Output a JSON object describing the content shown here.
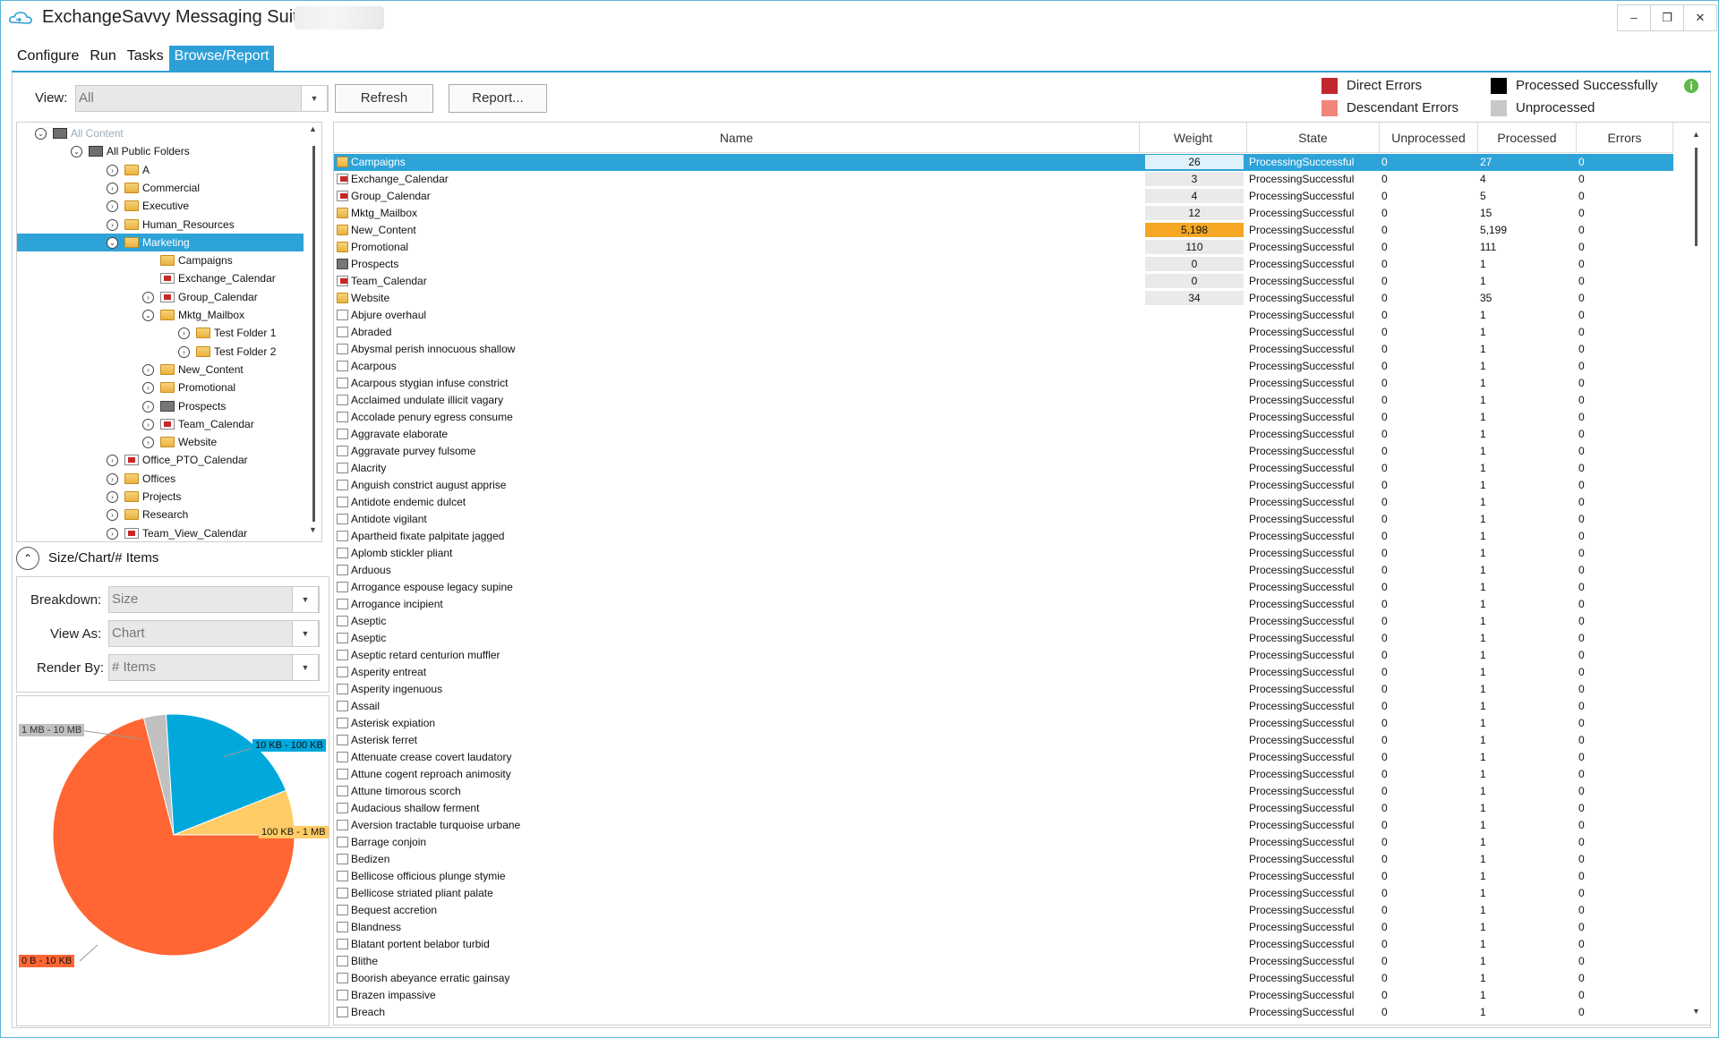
{
  "window": {
    "title": "ExchangeSavvy Messaging Suite -",
    "min_label": "–",
    "restore_label": "❐",
    "close_label": "✕"
  },
  "menu": [
    "Configure",
    "Run",
    "Tasks",
    "Browse/Report"
  ],
  "toolbar": {
    "view_label": "View:",
    "view_value": "All",
    "refresh_label": "Refresh",
    "report_label": "Report..."
  },
  "legend": [
    {
      "label": "Direct Errors",
      "color": "#c0282b"
    },
    {
      "label": "Descendant Errors",
      "color": "#f0857a"
    },
    {
      "label": "Processed Successfully",
      "color": "#000000"
    },
    {
      "label": "Unprocessed",
      "color": "#c8c8c8"
    }
  ],
  "tree": [
    {
      "label": "All Content",
      "icon": "server-icon",
      "exp": "minus",
      "depth": 0,
      "muted": true
    },
    {
      "label": "All Public Folders",
      "icon": "public-folders-icon",
      "exp": "minus",
      "depth": 1
    },
    {
      "label": "A",
      "icon": "folder-icon",
      "exp": "plus",
      "depth": 2
    },
    {
      "label": "Commercial",
      "icon": "folder-icon",
      "exp": "plus",
      "depth": 2
    },
    {
      "label": "Executive",
      "icon": "folder-icon",
      "exp": "plus",
      "depth": 2
    },
    {
      "label": "Human_Resources",
      "icon": "folder-icon",
      "exp": "plus",
      "depth": 2
    },
    {
      "label": "Marketing",
      "icon": "folder-icon",
      "exp": "minus",
      "depth": 2,
      "selected": true
    },
    {
      "label": "Campaigns",
      "icon": "folder-icon",
      "exp": "",
      "depth": 3
    },
    {
      "label": "Exchange_Calendar",
      "icon": "calendar-icon",
      "exp": "",
      "depth": 3
    },
    {
      "label": "Group_Calendar",
      "icon": "calendar-icon",
      "exp": "plus",
      "depth": 3
    },
    {
      "label": "Mktg_Mailbox",
      "icon": "folder-icon",
      "exp": "minus",
      "depth": 3
    },
    {
      "label": "Test Folder 1",
      "icon": "folder-icon",
      "exp": "plus",
      "depth": 4
    },
    {
      "label": "Test Folder 2",
      "icon": "folder-icon",
      "exp": "plus",
      "depth": 4
    },
    {
      "label": "New_Content",
      "icon": "folder-icon",
      "exp": "plus",
      "depth": 3
    },
    {
      "label": "Promotional",
      "icon": "folder-icon",
      "exp": "plus",
      "depth": 3
    },
    {
      "label": "Prospects",
      "icon": "contacts-icon",
      "exp": "plus",
      "depth": 3
    },
    {
      "label": "Team_Calendar",
      "icon": "calendar-icon",
      "exp": "plus",
      "depth": 3
    },
    {
      "label": "Website",
      "icon": "folder-icon",
      "exp": "plus",
      "depth": 3
    },
    {
      "label": "Office_PTO_Calendar",
      "icon": "calendar-icon",
      "exp": "plus",
      "depth": 2
    },
    {
      "label": "Offices",
      "icon": "folder-icon",
      "exp": "plus",
      "depth": 2
    },
    {
      "label": "Projects",
      "icon": "folder-icon",
      "exp": "plus",
      "depth": 2
    },
    {
      "label": "Research",
      "icon": "folder-icon",
      "exp": "plus",
      "depth": 2
    },
    {
      "label": "Team_View_Calendar",
      "icon": "calendar-icon",
      "exp": "plus",
      "depth": 2
    }
  ],
  "size_panel": {
    "title": "Size/Chart/# Items",
    "breakdown_label": "Breakdown:",
    "breakdown_value": "Size",
    "viewas_label": "View As:",
    "viewas_value": "Chart",
    "renderby_label": "Render By:",
    "renderby_value": "# Items"
  },
  "chart_data": {
    "type": "pie",
    "slices": [
      {
        "label": "0 B - 10 KB",
        "value": 71,
        "color": "#ff6633"
      },
      {
        "label": "10 KB - 100 KB",
        "value": 20,
        "color": "#00a8dc"
      },
      {
        "label": "100 KB - 1 MB",
        "value": 6,
        "color": "#ffcc66"
      },
      {
        "label": "1 MB - 10 MB",
        "value": 3,
        "color": "#c0c0c0"
      }
    ]
  },
  "grid": {
    "columns": [
      "Name",
      "Weight",
      "State",
      "Unprocessed",
      "Processed",
      "Errors"
    ],
    "rows": [
      {
        "name": "Campaigns",
        "icon": "folder-icon",
        "weight": "26",
        "state": "ProcessingSuccessful",
        "unprocessed": "0",
        "processed": "27",
        "errors": "0",
        "selected": true
      },
      {
        "name": "Exchange_Calendar",
        "icon": "calendar-icon",
        "weight": "3",
        "state": "ProcessingSuccessful",
        "unprocessed": "0",
        "processed": "4",
        "errors": "0"
      },
      {
        "name": "Group_Calendar",
        "icon": "calendar-icon",
        "weight": "4",
        "state": "ProcessingSuccessful",
        "unprocessed": "0",
        "processed": "5",
        "errors": "0"
      },
      {
        "name": "Mktg_Mailbox",
        "icon": "folder-icon",
        "weight": "12",
        "state": "ProcessingSuccessful",
        "unprocessed": "0",
        "processed": "15",
        "errors": "0"
      },
      {
        "name": "New_Content",
        "icon": "folder-icon",
        "weight": "5,198",
        "state": "ProcessingSuccessful",
        "unprocessed": "0",
        "processed": "5,199",
        "errors": "0",
        "hot": true
      },
      {
        "name": "Promotional",
        "icon": "folder-icon",
        "weight": "110",
        "state": "ProcessingSuccessful",
        "unprocessed": "0",
        "processed": "111",
        "errors": "0"
      },
      {
        "name": "Prospects",
        "icon": "contacts-icon",
        "weight": "0",
        "state": "ProcessingSuccessful",
        "unprocessed": "0",
        "processed": "1",
        "errors": "0"
      },
      {
        "name": "Team_Calendar",
        "icon": "calendar-icon",
        "weight": "0",
        "state": "ProcessingSuccessful",
        "unprocessed": "0",
        "processed": "1",
        "errors": "0"
      },
      {
        "name": "Website",
        "icon": "folder-icon",
        "weight": "34",
        "state": "ProcessingSuccessful",
        "unprocessed": "0",
        "processed": "35",
        "errors": "0"
      },
      {
        "name": "Abjure overhaul",
        "icon": "mail-icon",
        "weight": "",
        "state": "ProcessingSuccessful",
        "unprocessed": "0",
        "processed": "1",
        "errors": "0"
      },
      {
        "name": "Abraded",
        "icon": "mail-icon",
        "weight": "",
        "state": "ProcessingSuccessful",
        "unprocessed": "0",
        "processed": "1",
        "errors": "0"
      },
      {
        "name": "Abysmal perish innocuous shallow",
        "icon": "mail-icon",
        "weight": "",
        "state": "ProcessingSuccessful",
        "unprocessed": "0",
        "processed": "1",
        "errors": "0"
      },
      {
        "name": "Acarpous",
        "icon": "mail-icon",
        "weight": "",
        "state": "ProcessingSuccessful",
        "unprocessed": "0",
        "processed": "1",
        "errors": "0"
      },
      {
        "name": "Acarpous stygian infuse constrict",
        "icon": "mail-icon",
        "weight": "",
        "state": "ProcessingSuccessful",
        "unprocessed": "0",
        "processed": "1",
        "errors": "0"
      },
      {
        "name": "Acclaimed undulate illicit vagary",
        "icon": "mail-icon",
        "weight": "",
        "state": "ProcessingSuccessful",
        "unprocessed": "0",
        "processed": "1",
        "errors": "0"
      },
      {
        "name": "Accolade penury egress consume",
        "icon": "mail-icon",
        "weight": "",
        "state": "ProcessingSuccessful",
        "unprocessed": "0",
        "processed": "1",
        "errors": "0"
      },
      {
        "name": "Aggravate elaborate",
        "icon": "mail-icon",
        "weight": "",
        "state": "ProcessingSuccessful",
        "unprocessed": "0",
        "processed": "1",
        "errors": "0"
      },
      {
        "name": "Aggravate purvey fulsome",
        "icon": "mail-icon",
        "weight": "",
        "state": "ProcessingSuccessful",
        "unprocessed": "0",
        "processed": "1",
        "errors": "0"
      },
      {
        "name": "Alacrity",
        "icon": "mail-icon",
        "weight": "",
        "state": "ProcessingSuccessful",
        "unprocessed": "0",
        "processed": "1",
        "errors": "0"
      },
      {
        "name": "Anguish constrict august apprise",
        "icon": "mail-icon",
        "weight": "",
        "state": "ProcessingSuccessful",
        "unprocessed": "0",
        "processed": "1",
        "errors": "0"
      },
      {
        "name": "Antidote endemic dulcet",
        "icon": "mail-icon",
        "weight": "",
        "state": "ProcessingSuccessful",
        "unprocessed": "0",
        "processed": "1",
        "errors": "0"
      },
      {
        "name": "Antidote vigilant",
        "icon": "mail-icon",
        "weight": "",
        "state": "ProcessingSuccessful",
        "unprocessed": "0",
        "processed": "1",
        "errors": "0"
      },
      {
        "name": "Apartheid fixate palpitate jagged",
        "icon": "mail-icon",
        "weight": "",
        "state": "ProcessingSuccessful",
        "unprocessed": "0",
        "processed": "1",
        "errors": "0"
      },
      {
        "name": "Aplomb stickler pliant",
        "icon": "mail-icon",
        "weight": "",
        "state": "ProcessingSuccessful",
        "unprocessed": "0",
        "processed": "1",
        "errors": "0"
      },
      {
        "name": "Arduous",
        "icon": "mail-icon",
        "weight": "",
        "state": "ProcessingSuccessful",
        "unprocessed": "0",
        "processed": "1",
        "errors": "0"
      },
      {
        "name": "Arrogance espouse legacy supine",
        "icon": "mail-icon",
        "weight": "",
        "state": "ProcessingSuccessful",
        "unprocessed": "0",
        "processed": "1",
        "errors": "0"
      },
      {
        "name": "Arrogance incipient",
        "icon": "mail-icon",
        "weight": "",
        "state": "ProcessingSuccessful",
        "unprocessed": "0",
        "processed": "1",
        "errors": "0"
      },
      {
        "name": "Aseptic",
        "icon": "mail-icon",
        "weight": "",
        "state": "ProcessingSuccessful",
        "unprocessed": "0",
        "processed": "1",
        "errors": "0"
      },
      {
        "name": "Aseptic",
        "icon": "mail-icon",
        "weight": "",
        "state": "ProcessingSuccessful",
        "unprocessed": "0",
        "processed": "1",
        "errors": "0"
      },
      {
        "name": "Aseptic retard centurion muffler",
        "icon": "mail-icon",
        "weight": "",
        "state": "ProcessingSuccessful",
        "unprocessed": "0",
        "processed": "1",
        "errors": "0"
      },
      {
        "name": "Asperity entreat",
        "icon": "mail-icon",
        "weight": "",
        "state": "ProcessingSuccessful",
        "unprocessed": "0",
        "processed": "1",
        "errors": "0"
      },
      {
        "name": "Asperity ingenuous",
        "icon": "mail-icon",
        "weight": "",
        "state": "ProcessingSuccessful",
        "unprocessed": "0",
        "processed": "1",
        "errors": "0"
      },
      {
        "name": "Assail",
        "icon": "mail-icon",
        "weight": "",
        "state": "ProcessingSuccessful",
        "unprocessed": "0",
        "processed": "1",
        "errors": "0"
      },
      {
        "name": "Asterisk expiation",
        "icon": "mail-icon",
        "weight": "",
        "state": "ProcessingSuccessful",
        "unprocessed": "0",
        "processed": "1",
        "errors": "0"
      },
      {
        "name": "Asterisk ferret",
        "icon": "mail-icon",
        "weight": "",
        "state": "ProcessingSuccessful",
        "unprocessed": "0",
        "processed": "1",
        "errors": "0"
      },
      {
        "name": "Attenuate crease covert laudatory",
        "icon": "mail-icon",
        "weight": "",
        "state": "ProcessingSuccessful",
        "unprocessed": "0",
        "processed": "1",
        "errors": "0"
      },
      {
        "name": "Attune cogent reproach animosity",
        "icon": "mail-icon",
        "weight": "",
        "state": "ProcessingSuccessful",
        "unprocessed": "0",
        "processed": "1",
        "errors": "0"
      },
      {
        "name": "Attune timorous scorch",
        "icon": "mail-icon",
        "weight": "",
        "state": "ProcessingSuccessful",
        "unprocessed": "0",
        "processed": "1",
        "errors": "0"
      },
      {
        "name": "Audacious shallow ferment",
        "icon": "mail-icon",
        "weight": "",
        "state": "ProcessingSuccessful",
        "unprocessed": "0",
        "processed": "1",
        "errors": "0"
      },
      {
        "name": "Aversion tractable turquoise urbane",
        "icon": "mail-icon",
        "weight": "",
        "state": "ProcessingSuccessful",
        "unprocessed": "0",
        "processed": "1",
        "errors": "0"
      },
      {
        "name": "Barrage conjoin",
        "icon": "mail-icon",
        "weight": "",
        "state": "ProcessingSuccessful",
        "unprocessed": "0",
        "processed": "1",
        "errors": "0"
      },
      {
        "name": "Bedizen",
        "icon": "mail-icon",
        "weight": "",
        "state": "ProcessingSuccessful",
        "unprocessed": "0",
        "processed": "1",
        "errors": "0"
      },
      {
        "name": "Bellicose officious plunge stymie",
        "icon": "mail-icon",
        "weight": "",
        "state": "ProcessingSuccessful",
        "unprocessed": "0",
        "processed": "1",
        "errors": "0"
      },
      {
        "name": "Bellicose striated pliant palate",
        "icon": "mail-icon",
        "weight": "",
        "state": "ProcessingSuccessful",
        "unprocessed": "0",
        "processed": "1",
        "errors": "0"
      },
      {
        "name": "Bequest accretion",
        "icon": "mail-icon",
        "weight": "",
        "state": "ProcessingSuccessful",
        "unprocessed": "0",
        "processed": "1",
        "errors": "0"
      },
      {
        "name": "Blandness",
        "icon": "mail-icon",
        "weight": "",
        "state": "ProcessingSuccessful",
        "unprocessed": "0",
        "processed": "1",
        "errors": "0"
      },
      {
        "name": "Blatant portent belabor turbid",
        "icon": "mail-icon",
        "weight": "",
        "state": "ProcessingSuccessful",
        "unprocessed": "0",
        "processed": "1",
        "errors": "0"
      },
      {
        "name": "Blithe",
        "icon": "mail-icon",
        "weight": "",
        "state": "ProcessingSuccessful",
        "unprocessed": "0",
        "processed": "1",
        "errors": "0"
      },
      {
        "name": "Boorish abeyance erratic gainsay",
        "icon": "mail-icon",
        "weight": "",
        "state": "ProcessingSuccessful",
        "unprocessed": "0",
        "processed": "1",
        "errors": "0"
      },
      {
        "name": "Brazen impassive",
        "icon": "mail-icon",
        "weight": "",
        "state": "ProcessingSuccessful",
        "unprocessed": "0",
        "processed": "1",
        "errors": "0"
      },
      {
        "name": "Breach",
        "icon": "mail-icon",
        "weight": "",
        "state": "ProcessingSuccessful",
        "unprocessed": "0",
        "processed": "1",
        "errors": "0"
      }
    ]
  }
}
